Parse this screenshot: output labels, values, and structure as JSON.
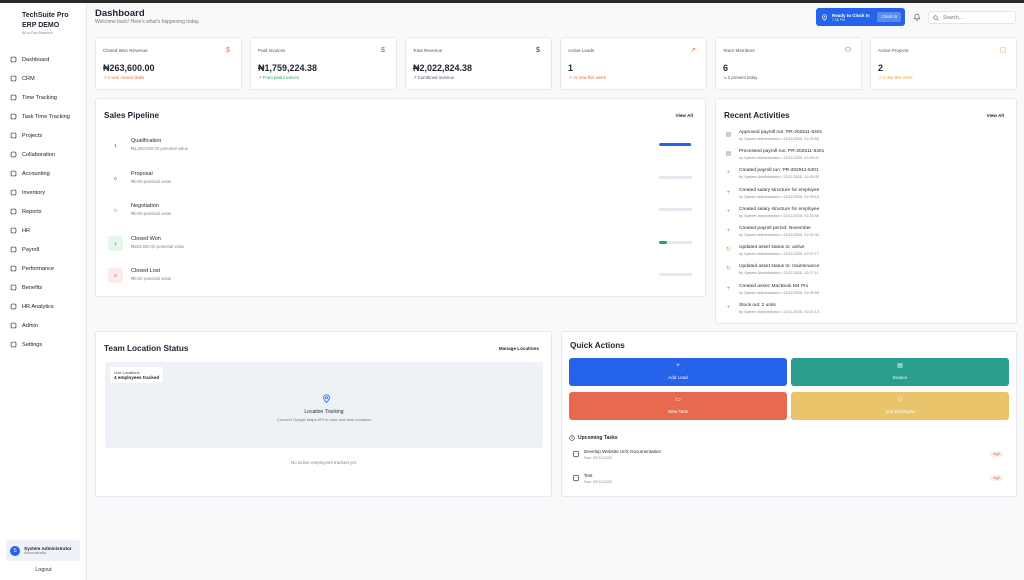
{
  "app": {
    "title": "TechSuite Pro ERP DEMO",
    "subtitle": "All-in-One Business"
  },
  "sidebar": {
    "items": [
      {
        "label": "Dashboard",
        "icon": "grid-icon"
      },
      {
        "label": "CRM",
        "icon": "users-icon"
      },
      {
        "label": "Time Tracking",
        "icon": "clock-icon"
      },
      {
        "label": "Task Time Tracking",
        "icon": "timer-icon"
      },
      {
        "label": "Projects",
        "icon": "briefcase-icon"
      },
      {
        "label": "Collaboration",
        "icon": "chat-icon"
      },
      {
        "label": "Accounting",
        "icon": "calculator-icon"
      },
      {
        "label": "Inventory",
        "icon": "box-icon"
      },
      {
        "label": "Reports",
        "icon": "chart-icon"
      },
      {
        "label": "HR",
        "icon": "id-card-icon"
      },
      {
        "label": "Payroll",
        "icon": "wallet-icon"
      },
      {
        "label": "Performance",
        "icon": "target-icon"
      },
      {
        "label": "Benefits",
        "icon": "heart-icon"
      },
      {
        "label": "HR Analytics",
        "icon": "analytics-icon"
      },
      {
        "label": "Admin",
        "icon": "shield-icon"
      },
      {
        "label": "Settings",
        "icon": "gear-icon"
      }
    ],
    "user": {
      "initial": "S",
      "name": "System Administrator",
      "role": "Administrator"
    },
    "logout": "Logout"
  },
  "header": {
    "title": "Dashboard",
    "subtitle": "Welcome back! Here's what's happening today.",
    "clock": {
      "status": "Ready to Clock In",
      "time": "7:36 PM",
      "button": "Clock In"
    },
    "search_placeholder": "Search..."
  },
  "stats": [
    {
      "label": "Closed Won Revenue",
      "value": "₦263,600.00",
      "note": "↗ 1 won closed deals",
      "icon": "dollar-icon",
      "icon_color": "#e76a3c",
      "note_color": "#e76a3c"
    },
    {
      "label": "Paid Invoices",
      "value": "₦1,759,224.38",
      "note": "↗ From paid invoices",
      "icon": "dollar-icon",
      "icon_color": "#22a06b",
      "note_color": "#22a06b"
    },
    {
      "label": "Total Revenue",
      "value": "₦2,022,824.38",
      "note": "↗ Combined revenue",
      "icon": "dollar-icon",
      "icon_color": "#333333",
      "note_color": "#555555"
    },
    {
      "label": "Active Leads",
      "value": "1",
      "note": "↗ +6 new this week",
      "icon": "trend-icon",
      "icon_color": "#e76a3c",
      "note_color": "#e76a3c"
    },
    {
      "label": "Team Members",
      "value": "6",
      "note": "↘ 2 present today",
      "icon": "team-icon",
      "icon_color": "#444444",
      "note_color": "#555555"
    },
    {
      "label": "Active Projects",
      "value": "2",
      "note": "↗ 3 due this week",
      "icon": "folder-icon",
      "icon_color": "#e7a33c",
      "note_color": "#e7a33c"
    }
  ],
  "pipeline": {
    "title": "Sales Pipeline",
    "view_all": "View All",
    "stages": [
      {
        "badge": "1",
        "name": "Qualification",
        "value": "₦1,050,000.00 potential value",
        "fill": 0.97,
        "bar_color": "#2563eb",
        "badge_bg": "#ffffff",
        "badge_color": "#555555"
      },
      {
        "badge": "0",
        "name": "Proposal",
        "value": "₦0.00 potential value",
        "fill": 0,
        "bar_color": "#2563eb",
        "badge_bg": "#ffffff",
        "badge_color": "#555555"
      },
      {
        "badge": "0",
        "name": "Negotiation",
        "value": "₦0.00 potential value",
        "fill": 0,
        "bar_color": "#2563eb",
        "badge_bg": "#ffffff",
        "badge_color": "#e76a3c"
      },
      {
        "badge": "1",
        "name": "Closed Won",
        "value": "₦263,600.00 potential value",
        "fill": 0.25,
        "bar_color": "#22a06b",
        "badge_bg": "#e8f7ee",
        "badge_color": "#22a06b"
      },
      {
        "badge": "0",
        "name": "Closed Lost",
        "value": "₦0.00 potential value",
        "fill": 0,
        "bar_color": "#e5484d",
        "badge_bg": "#fdecec",
        "badge_color": "#e5484d"
      }
    ]
  },
  "activities": {
    "title": "Recent Activities",
    "view_all": "View All",
    "items": [
      {
        "icon": "document-icon",
        "glyph": "▤",
        "color": "#8a94a6",
        "title": "Approved payroll run: PR-202511-5401",
        "meta": "by System Administrator  •  22/11/2025, 02:35:53"
      },
      {
        "icon": "document-icon",
        "glyph": "▤",
        "color": "#8a94a6",
        "title": "Processed payroll run: PR-202511-5401",
        "meta": "by System Administrator  •  22/11/2025, 02:35:41"
      },
      {
        "icon": "plus-icon",
        "glyph": "+",
        "color": "#8a94a6",
        "title": "Created payroll run: PR-202511-5401",
        "meta": "by System Administrator  •  22/11/2025, 02:35:35"
      },
      {
        "icon": "plus-icon",
        "glyph": "+",
        "color": "#8a94a6",
        "title": "Created salary structure for employee",
        "meta": "by System Administrator  •  22/11/2025, 02:35:16"
      },
      {
        "icon": "plus-icon",
        "glyph": "+",
        "color": "#8a94a6",
        "title": "Created salary structure for employee",
        "meta": "by System Administrator  •  22/11/2025, 02:34:55"
      },
      {
        "icon": "plus-icon",
        "glyph": "+",
        "color": "#8a94a6",
        "title": "Created payroll period: November",
        "meta": "by System Administrator  •  22/11/2025, 02:32:34"
      },
      {
        "icon": "refresh-icon",
        "glyph": "↻",
        "color": "#e7a33c",
        "title": "Updated asset status to: active",
        "meta": "by System Administrator  •  22/11/2025, 02:27:17"
      },
      {
        "icon": "refresh-icon",
        "glyph": "↻",
        "color": "#e7a33c",
        "title": "Updated asset status to: maintenance",
        "meta": "by System Administrator  •  22/11/2025, 02:27:11"
      },
      {
        "icon": "plus-icon",
        "glyph": "+",
        "color": "#8a94a6",
        "title": "Created asset: MacBook M4 Pro",
        "meta": "by System Administrator  •  22/11/2025, 02:26:59"
      },
      {
        "icon": "plus-icon",
        "glyph": "+",
        "color": "#8a94a6",
        "title": "Stock out: 2 units",
        "meta": "by System Administrator  •  22/11/2025, 02:21:13"
      }
    ]
  },
  "location": {
    "title": "Team Location Status",
    "manage": "Manage Locations",
    "live_label": "Live Locations",
    "live_count": "4 employees tracked",
    "map_title": "Location Tracking",
    "map_sub": "Connect Google Maps API to view real-time locations",
    "no_employees": "No active employees tracked yet"
  },
  "quick_actions": {
    "title": "Quick Actions",
    "buttons": [
      {
        "label": "Add Lead",
        "icon": "plus-icon",
        "glyph": "+",
        "color": "#2563eb"
      },
      {
        "label": "Invoice",
        "icon": "document-icon",
        "glyph": "▤",
        "color": "#2a9d8f"
      },
      {
        "label": "New Task",
        "icon": "calendar-icon",
        "glyph": "▭",
        "color": "#e76a50"
      },
      {
        "label": "Add Employee",
        "icon": "user-plus-icon",
        "glyph": "⚇",
        "color": "#e9c46a"
      }
    ],
    "tasks_title": "Upcoming Tasks",
    "tasks": [
      {
        "title": "Develop Website UI/X Documentation",
        "due": "Due: 25/11/2025",
        "priority": "high"
      },
      {
        "title": "Test",
        "due": "Due: 26/11/2025",
        "priority": "high"
      }
    ]
  }
}
